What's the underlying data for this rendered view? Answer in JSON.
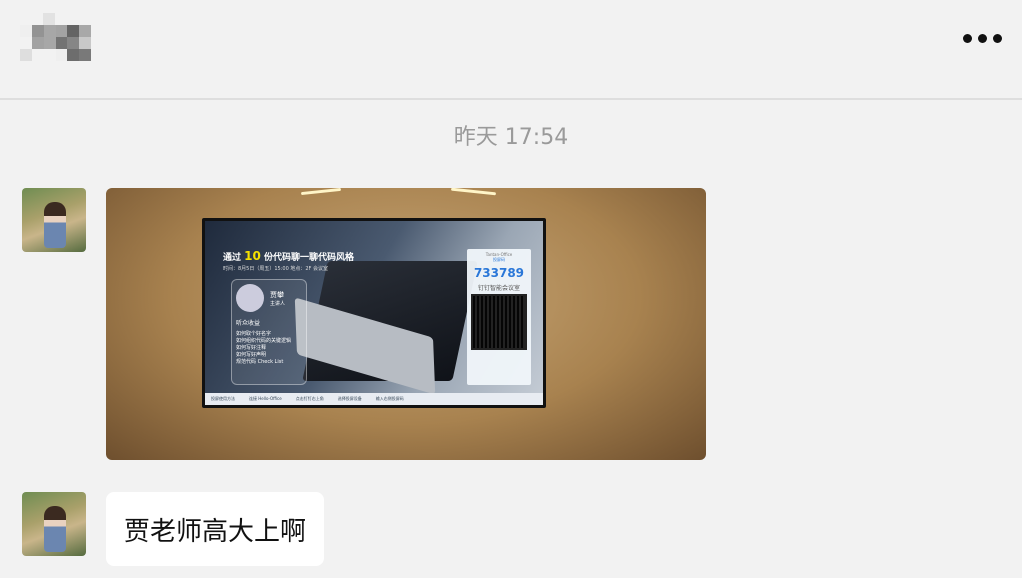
{
  "header": {
    "more_label": "more options"
  },
  "chat": {
    "timestamp": "昨天 17:54",
    "photo": {
      "title_prefix": "通过",
      "title_number": "10",
      "title_suffix": "份代码聊一聊代码风格",
      "subtitle": "时间：8月5日（周五）15:00    地点：2F 会议室",
      "speaker_name": "贾攀",
      "speaker_role": "主讲人",
      "benefits_title": "听众收益",
      "benefits": [
        "如何取个好名字",
        "如何组织代码的关键逻辑",
        "如何写好注释",
        "如何写好声明",
        "规范代码 Check List"
      ],
      "wifi": "Tantan-Office",
      "code_label": "投屏码",
      "code": "733789",
      "room": "钉钉智能会议室",
      "bottom_bar": [
        "投屏使用方法",
        "连接 Hello-Office",
        "点击钉钉右上角",
        "选择投屏设备",
        "输入右侧投屏码"
      ]
    },
    "message_text": "贾老师高大上啊"
  }
}
